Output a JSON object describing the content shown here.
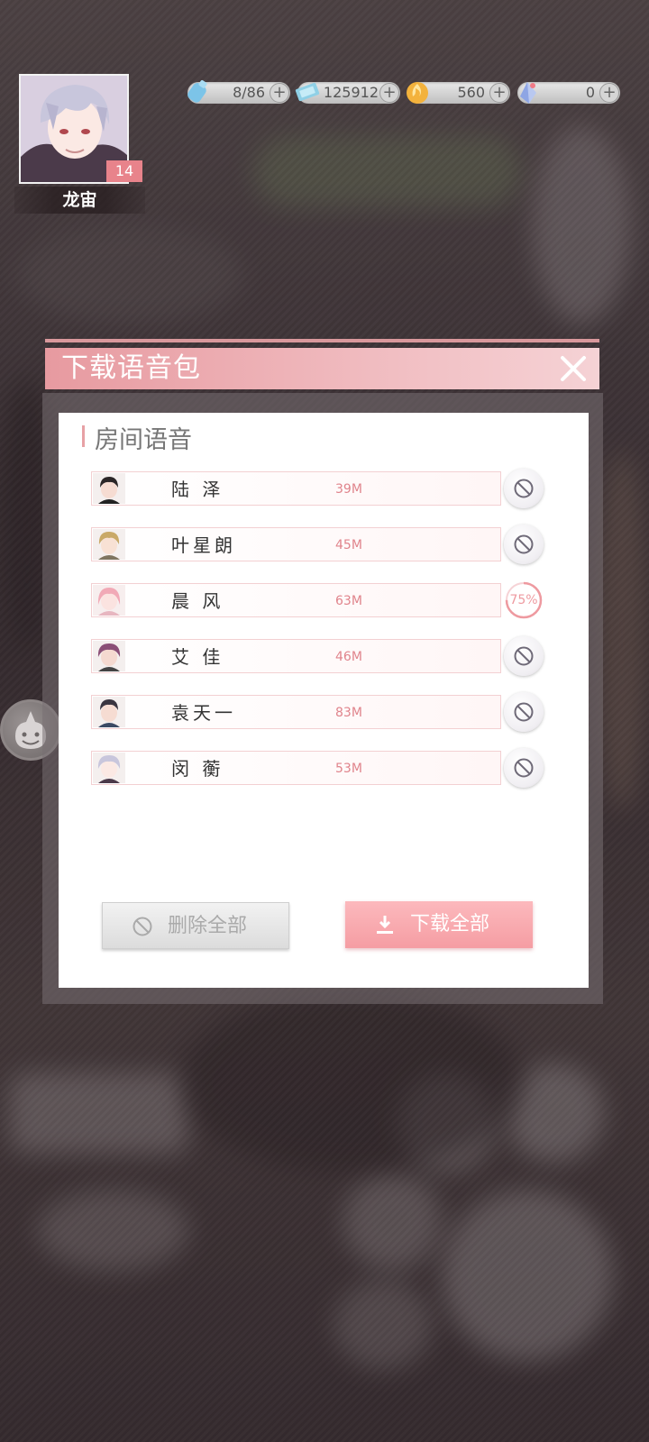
{
  "profile": {
    "name": "龙宙",
    "level": "14"
  },
  "resources": [
    {
      "icon": "bottle-icon",
      "value": "8/86"
    },
    {
      "icon": "ticket-icon",
      "value": "125912"
    },
    {
      "icon": "flame-coin-icon",
      "value": "560"
    },
    {
      "icon": "crystal-icon",
      "value": "0"
    }
  ],
  "dialog": {
    "title": "下载语音包",
    "section_title": "房间语音",
    "items": [
      {
        "name": "陆 泽",
        "size": "39M",
        "status": "not-downloaded"
      },
      {
        "name": "叶星朗",
        "size": "45M",
        "status": "not-downloaded"
      },
      {
        "name": "晨 风",
        "size": "63M",
        "status": "downloading",
        "progress_text": "75%",
        "progress": 0.75
      },
      {
        "name": "艾 佳",
        "size": "46M",
        "status": "not-downloaded"
      },
      {
        "name": "袁天一",
        "size": "83M",
        "status": "not-downloaded"
      },
      {
        "name": "闵 蘅",
        "size": "53M",
        "status": "not-downloaded"
      }
    ],
    "delete_all_label": "删除全部",
    "download_all_label": "下载全部"
  },
  "colors": {
    "accent": "#f59da3",
    "header": "#e79aa0",
    "size_text": "#e0848c"
  }
}
